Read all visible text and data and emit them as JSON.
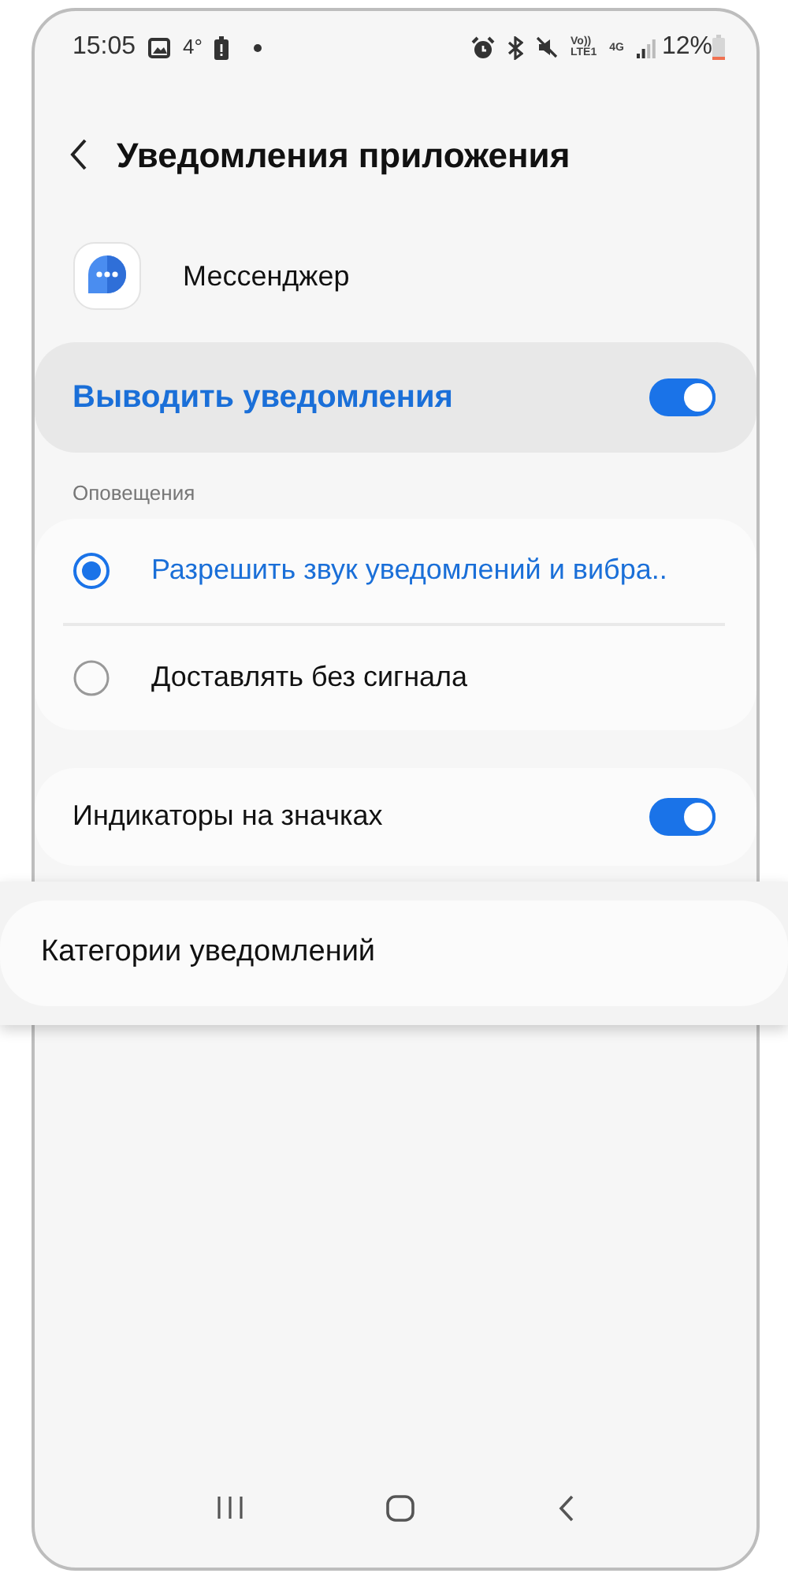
{
  "status_bar": {
    "time": "15:05",
    "temperature": "4°",
    "volte": "Vo))",
    "lte": "LTE1",
    "network": "4G",
    "battery": "12%"
  },
  "header": {
    "title": "Уведомления приложения"
  },
  "app": {
    "name": "Мессенджер"
  },
  "master_toggle": {
    "label": "Выводить уведомления",
    "on": true
  },
  "alerts": {
    "section_title": "Оповещения",
    "options": [
      {
        "label": "Разрешить звук уведомлений и вибра..",
        "selected": true
      },
      {
        "label": "Доставлять без сигнала",
        "selected": false
      }
    ]
  },
  "badges_toggle": {
    "label": "Индикаторы на значках",
    "on": true
  },
  "categories": {
    "label": "Категории уведомлений"
  }
}
